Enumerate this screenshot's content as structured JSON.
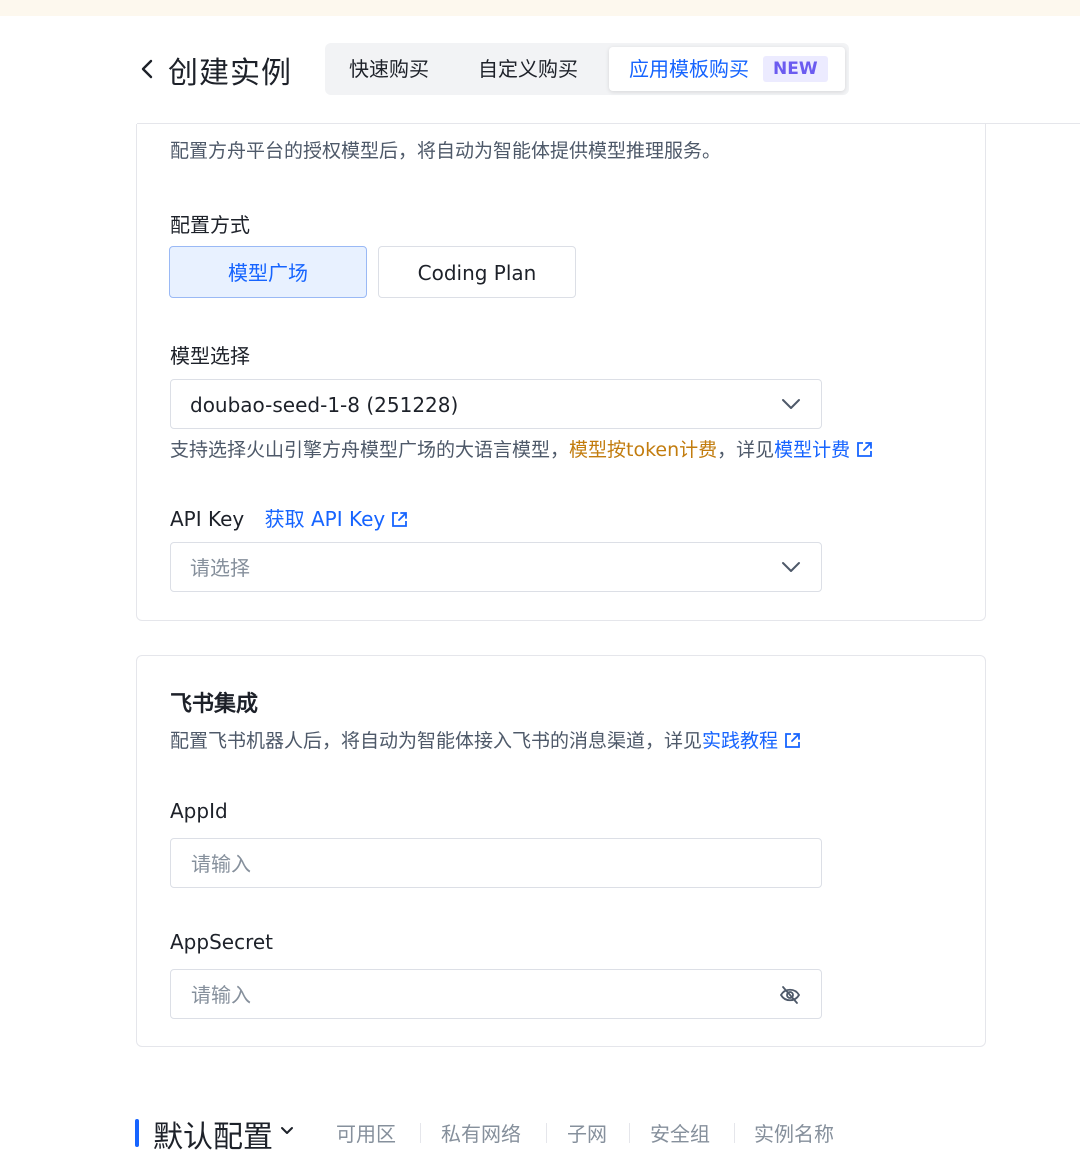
{
  "header": {
    "title": "创建实例",
    "tabs": {
      "quick": "快速购买",
      "custom": "自定义购买",
      "template": "应用模板购买",
      "template_badge": "NEW"
    }
  },
  "model_config": {
    "description": "配置方舟平台的授权模型后，将自动为智能体提供模型推理服务。",
    "mode_label": "配置方式",
    "mode_options": [
      "模型广场",
      "Coding Plan"
    ],
    "model_label": "模型选择",
    "model_value": "doubao-seed-1-8 (251228)",
    "model_help_prefix": "支持选择火山引擎方舟模型广场的大语言模型，",
    "model_help_billing": "模型按token计费",
    "model_help_mid": "，详见",
    "model_help_link": "模型计费",
    "api_key_label": "API Key",
    "api_key_link": "获取 API Key",
    "api_key_placeholder": "请选择"
  },
  "feishu": {
    "title": "飞书集成",
    "description_prefix": "配置飞书机器人后，将自动为智能体接入飞书的消息渠道，详见",
    "description_link": "实践教程",
    "appid_label": "AppId",
    "appid_placeholder": "请输入",
    "appsecret_label": "AppSecret",
    "appsecret_placeholder": "请输入"
  },
  "bottom_nav": {
    "title": "默认配置",
    "items": [
      "可用区",
      "私有网络",
      "子网",
      "安全组",
      "实例名称"
    ]
  },
  "colors": {
    "accent": "#1664ff",
    "billing": "#c27c0e",
    "badge_text": "#6b5bf0"
  }
}
